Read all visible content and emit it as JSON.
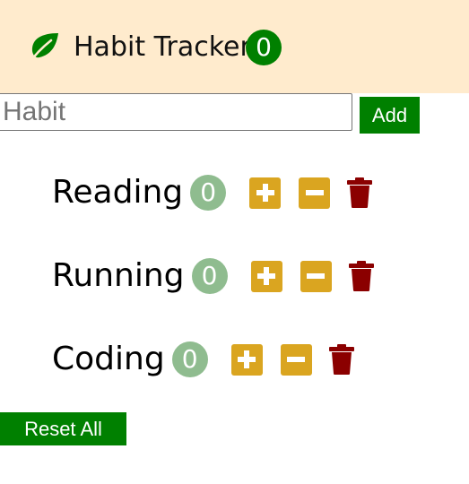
{
  "header": {
    "title": "Habit Tracker",
    "total_count": "0",
    "icon": "leaf-icon",
    "background": "#ffebcd"
  },
  "form": {
    "input_placeholder": "Habit",
    "input_value": "",
    "add_label": "Add"
  },
  "habits": [
    {
      "name": "Reading",
      "count": "0"
    },
    {
      "name": "Running",
      "count": "0"
    },
    {
      "name": "Coding",
      "count": "0"
    }
  ],
  "icons": {
    "increment": "plus-icon",
    "decrement": "minus-icon",
    "delete": "trash-icon"
  },
  "footer": {
    "reset_label": "Reset All"
  },
  "colors": {
    "primary_green": "#008000",
    "count_badge": "#8fbc8f",
    "control_gold": "#daa520",
    "trash_red": "#8b0000"
  }
}
